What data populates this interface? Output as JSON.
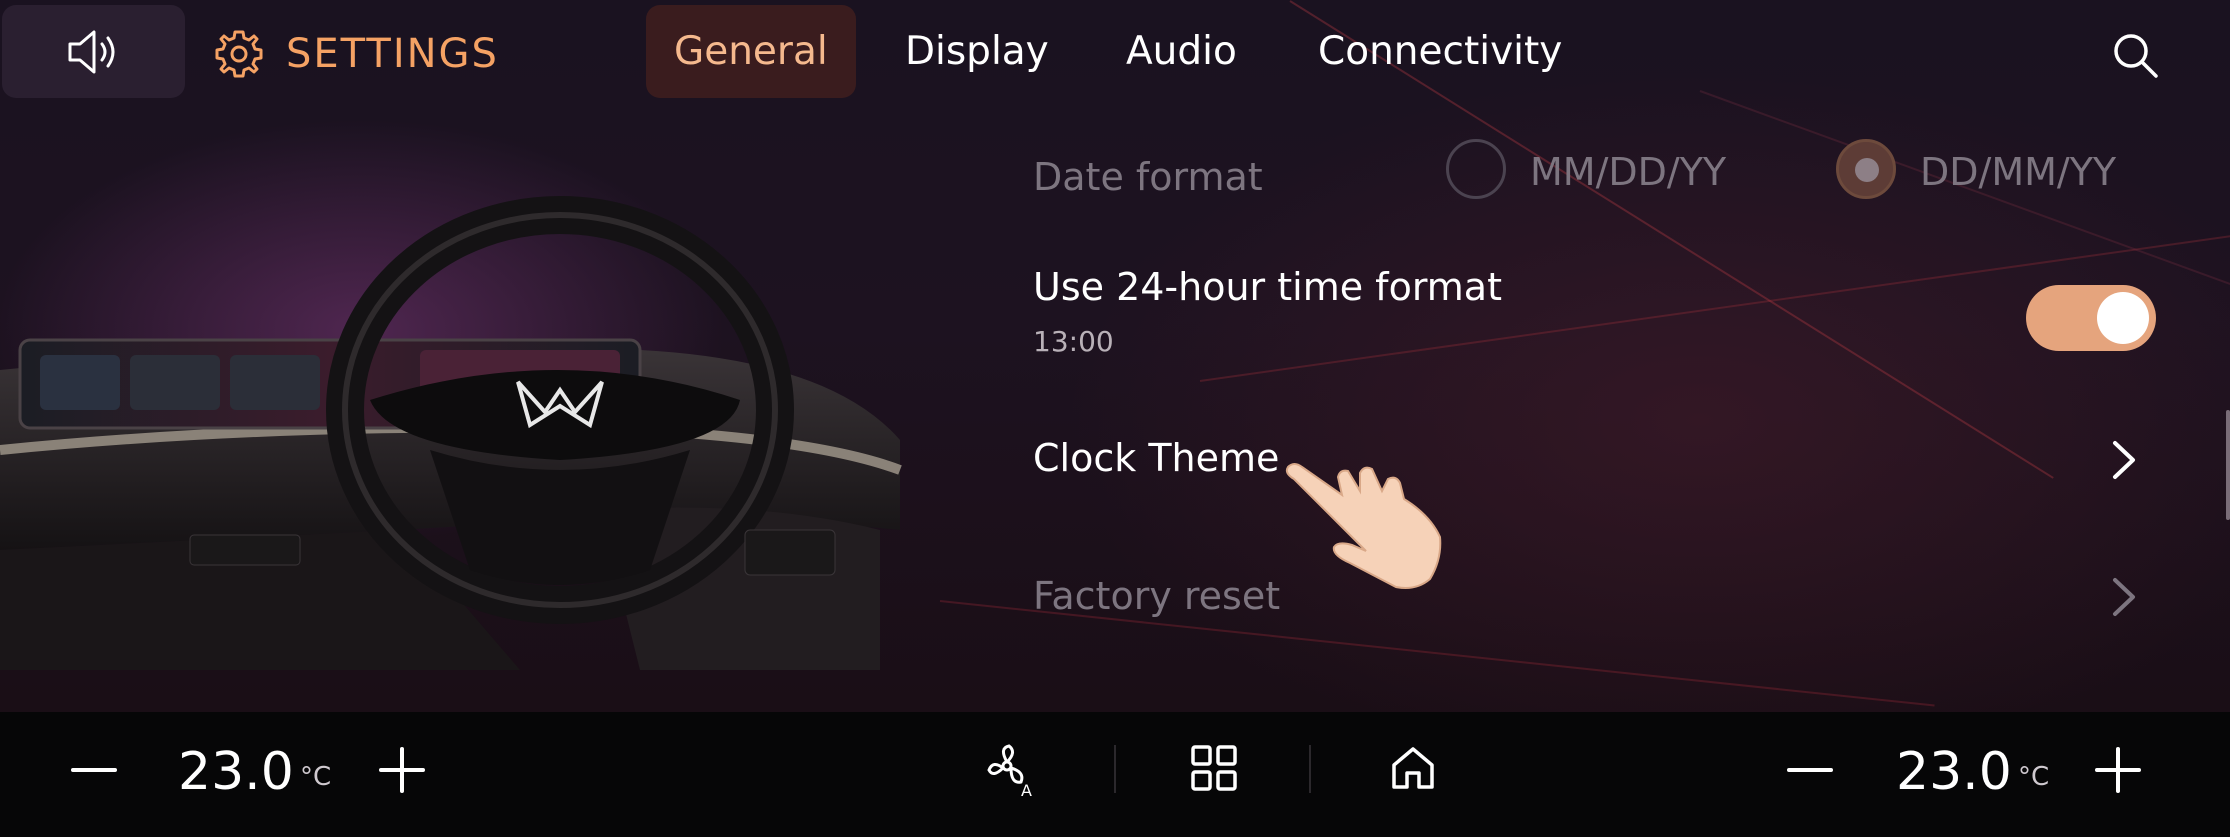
{
  "header": {
    "title": "SETTINGS",
    "tabs": [
      {
        "label": "General",
        "active": true
      },
      {
        "label": "Display",
        "active": false
      },
      {
        "label": "Audio",
        "active": false
      },
      {
        "label": "Connectivity",
        "active": false
      }
    ]
  },
  "general": {
    "date_format": {
      "label": "Date format",
      "options": [
        "MM/DD/YY",
        "DD/MM/YY"
      ],
      "selected": "DD/MM/YY"
    },
    "time_format": {
      "label": "Use 24-hour time format",
      "preview": "13:00",
      "enabled": true
    },
    "clock_theme": {
      "label": "Clock Theme"
    },
    "factory_reset": {
      "label": "Factory reset"
    }
  },
  "climate": {
    "left_temp": "23.0",
    "right_temp": "23.0",
    "unit": "°C"
  },
  "colors": {
    "accent": "#f5a264",
    "toggle_on": "#e5a47d",
    "active_tab_bg": "#3a1c1e"
  },
  "icons": [
    "volume-icon",
    "gear-icon",
    "search-icon",
    "chevron-right-icon",
    "minus-icon",
    "plus-icon",
    "fan-auto-icon",
    "grid-icon",
    "home-icon",
    "hand-pointer-icon"
  ]
}
